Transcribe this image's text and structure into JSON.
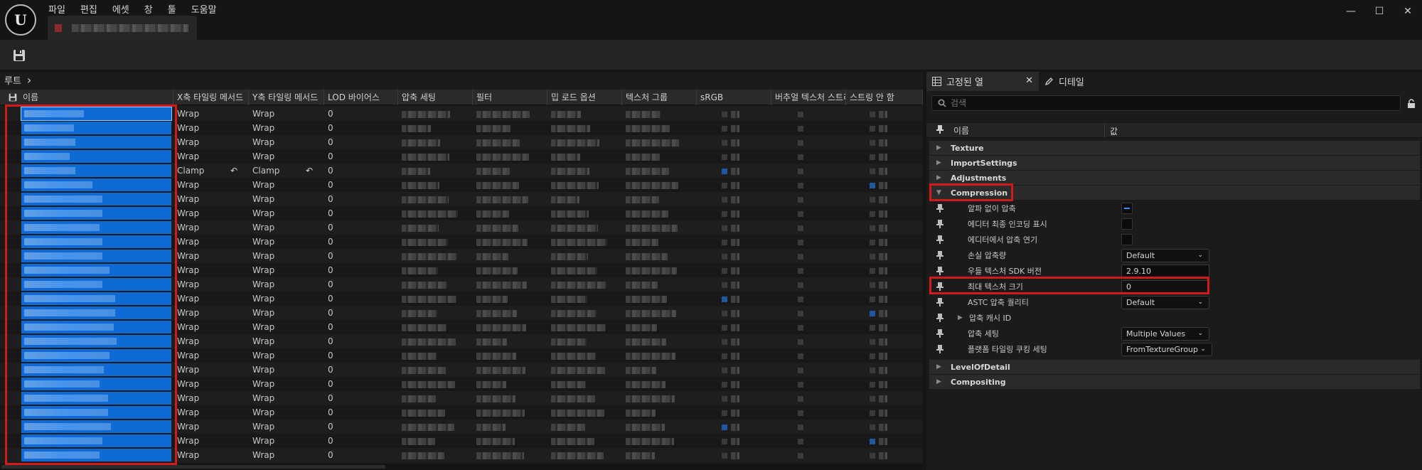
{
  "menubar": {
    "items": [
      "파일",
      "편집",
      "에셋",
      "창",
      "툴",
      "도움말"
    ]
  },
  "window_controls": {
    "minimize": "—",
    "maximize": "☐",
    "close": "✕"
  },
  "breadcrumb": {
    "root": "루트",
    "separator": "›"
  },
  "grid": {
    "columns": [
      "이름",
      "X축 타일링 메서드",
      "Y축 타일링 메서드",
      "LOD 바이어스",
      "압축 세팅",
      "필터",
      "밉 로드 옵션",
      "텍스처 그룹",
      "sRGB",
      "버추얼 텍스처 스트리밍",
      "스트링 안 함"
    ],
    "rows": [
      {
        "x": "Wrap",
        "y": "Wrap",
        "lod": "0",
        "revert": false
      },
      {
        "x": "Wrap",
        "y": "Wrap",
        "lod": "0",
        "revert": false
      },
      {
        "x": "Wrap",
        "y": "Wrap",
        "lod": "0",
        "revert": false
      },
      {
        "x": "Wrap",
        "y": "Wrap",
        "lod": "0",
        "revert": false
      },
      {
        "x": "Clamp",
        "y": "Clamp",
        "lod": "0",
        "revert": true
      },
      {
        "x": "Wrap",
        "y": "Wrap",
        "lod": "0",
        "revert": false
      },
      {
        "x": "Wrap",
        "y": "Wrap",
        "lod": "0",
        "revert": false
      },
      {
        "x": "Wrap",
        "y": "Wrap",
        "lod": "0",
        "revert": false
      },
      {
        "x": "Wrap",
        "y": "Wrap",
        "lod": "0",
        "revert": false
      },
      {
        "x": "Wrap",
        "y": "Wrap",
        "lod": "0",
        "revert": false
      },
      {
        "x": "Wrap",
        "y": "Wrap",
        "lod": "0",
        "revert": false
      },
      {
        "x": "Wrap",
        "y": "Wrap",
        "lod": "0",
        "revert": false
      },
      {
        "x": "Wrap",
        "y": "Wrap",
        "lod": "0",
        "revert": false
      },
      {
        "x": "Wrap",
        "y": "Wrap",
        "lod": "0",
        "revert": false
      },
      {
        "x": "Wrap",
        "y": "Wrap",
        "lod": "0",
        "revert": false
      },
      {
        "x": "Wrap",
        "y": "Wrap",
        "lod": "0",
        "revert": false
      },
      {
        "x": "Wrap",
        "y": "Wrap",
        "lod": "0",
        "revert": false
      },
      {
        "x": "Wrap",
        "y": "Wrap",
        "lod": "0",
        "revert": false
      },
      {
        "x": "Wrap",
        "y": "Wrap",
        "lod": "0",
        "revert": false
      },
      {
        "x": "Wrap",
        "y": "Wrap",
        "lod": "0",
        "revert": false
      },
      {
        "x": "Wrap",
        "y": "Wrap",
        "lod": "0",
        "revert": false
      },
      {
        "x": "Wrap",
        "y": "Wrap",
        "lod": "0",
        "revert": false
      },
      {
        "x": "Wrap",
        "y": "Wrap",
        "lod": "0",
        "revert": false
      },
      {
        "x": "Wrap",
        "y": "Wrap",
        "lod": "0",
        "revert": false
      },
      {
        "x": "Wrap",
        "y": "Wrap",
        "lod": "0",
        "revert": false
      }
    ]
  },
  "details": {
    "tabs": {
      "pinned_columns": "고정된 열",
      "details": "디테일"
    },
    "search_placeholder": "검색",
    "header": {
      "name": "이름",
      "value": "값"
    },
    "categories": {
      "texture": "Texture",
      "import_settings": "ImportSettings",
      "adjustments": "Adjustments",
      "compression": "Compression",
      "level_of_detail": "LevelOfDetail",
      "compositing": "Compositing"
    },
    "compression_props": {
      "compress_without_alpha": "알파 없이 압축",
      "show_final_encoding": "에디터 최종 인코딩 표시",
      "defer_compression": "에디터에서 압축 연기",
      "lossy_compression": "손실 압축량",
      "lossy_value": "Default",
      "oodle_sdk_version": "우들 텍스처 SDK 버전",
      "oodle_sdk_value": "2.9.10",
      "max_texture_size": "최대 텍스처 크기",
      "max_texture_size_value": "0",
      "astc_quality": "ASTC 압축 퀄리티",
      "astc_value": "Default",
      "compression_cache_id": "압축 캐시 ID",
      "compression_settings": "압축 세팅",
      "compression_settings_value": "Multiple Values",
      "platform_tiling": "플랫폼 타일링 쿠킹 세팅",
      "platform_tiling_value": "FromTextureGroup"
    }
  }
}
